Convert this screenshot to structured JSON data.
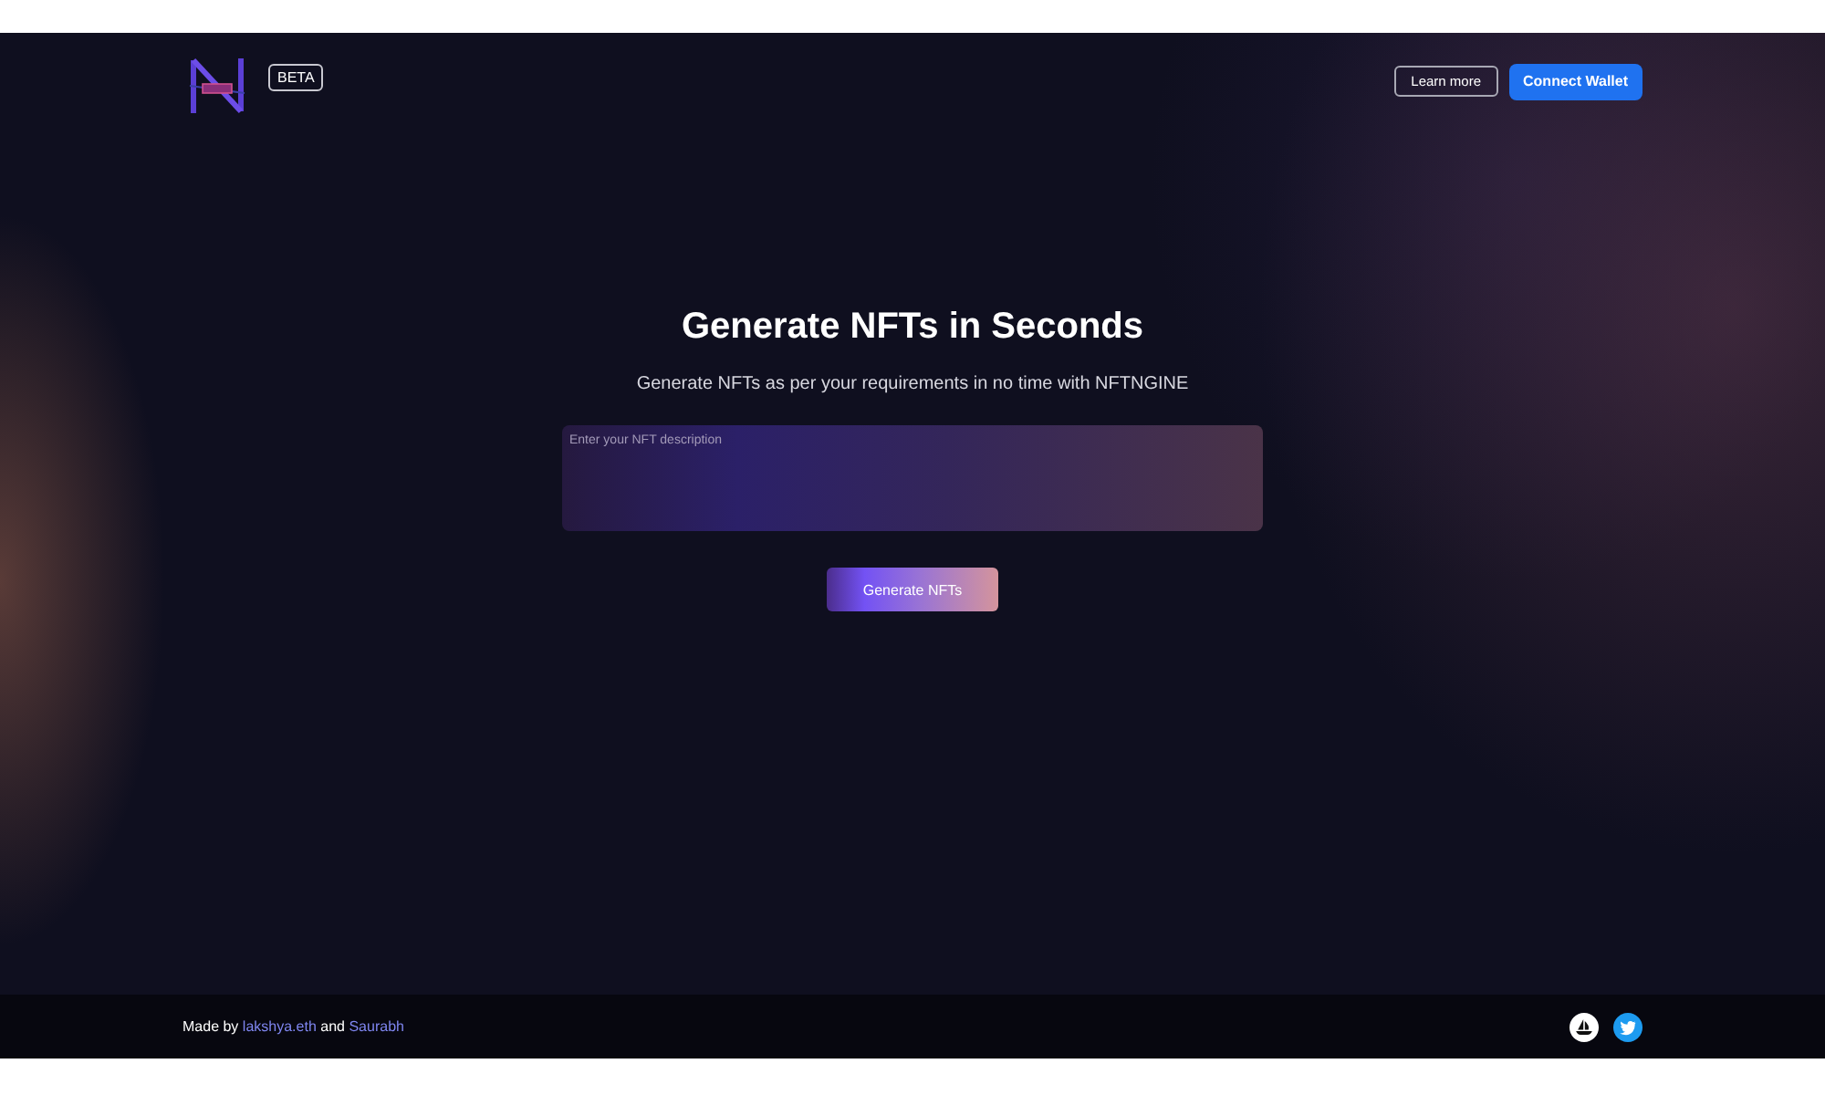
{
  "header": {
    "badge": "BETA",
    "buttons": [
      {
        "label": "Learn more",
        "kind": "outline"
      },
      {
        "label": "Connect Wallet",
        "kind": "primary"
      }
    ]
  },
  "hero": {
    "title": "Generate NFTs in Seconds",
    "subtitle": "Generate NFTs as per your requirements in no time with NFTNGINE",
    "description_field": {
      "placeholder": "Enter your NFT description"
    },
    "button": "Generate NFTs"
  },
  "footer": {
    "credit": [
      {
        "kind": "text",
        "text": "Made by"
      },
      {
        "kind": "link",
        "text": "lakshya.eth"
      },
      {
        "kind": "text",
        "text": "and"
      },
      {
        "kind": "link",
        "text": "Saurabh"
      }
    ]
  }
}
